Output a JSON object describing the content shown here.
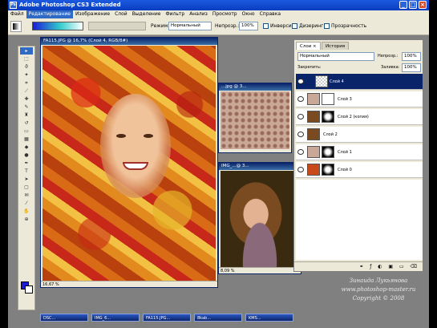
{
  "titlebar": {
    "title": "Adobe Photoshop CS3 Extended"
  },
  "menu": [
    "Файл",
    "Редактирование",
    "Изображение",
    "Слой",
    "Выделение",
    "Фильтр",
    "Анализ",
    "Просмотр",
    "Окно",
    "Справка"
  ],
  "options": {
    "mode_label": "Режим:",
    "mode_value": "Нормальный",
    "opacity_label": "Непрозр.:",
    "opacity_value": "100%",
    "invert": "Инверсия",
    "dither": "Дизеринг",
    "transparency": "Прозрачность"
  },
  "docs": {
    "main": {
      "title": "FA115.JPG @ 16,7% (Слой 4, RGB/8#)",
      "zoom": "16,67 %"
    },
    "pattern": {
      "title": "...jpg @ 3..."
    },
    "photo": {
      "title": "IMG_...@ 3..."
    },
    "photo_zoom": "8,09 %"
  },
  "layers": {
    "tab_layers": "Слои ×",
    "tab_history": "История",
    "blend": "Нормальный",
    "opacity_label": "Непрозр.:",
    "opacity_value": "100%",
    "lock_label": "Закрепить:",
    "fill_label": "Заливка:",
    "fill_value": "100%",
    "rows": [
      {
        "name": "Слой 4",
        "selected": true
      },
      {
        "name": "Слой 3",
        "selected": false
      },
      {
        "name": "Слой 2 (копия)",
        "selected": false
      },
      {
        "name": "Слой 2",
        "selected": false
      },
      {
        "name": "Слой 1",
        "selected": false
      },
      {
        "name": "Слой 0",
        "selected": false
      }
    ]
  },
  "taskbar": [
    "DSC...",
    "IMG_6...",
    "FA115.JPG...",
    "8kab...",
    "KMS..."
  ],
  "signature": {
    "line1": "Зинаида Лукьянова",
    "line2": "www.photoshop-master.ru",
    "line3": "Copyright © 2008"
  },
  "colors": {
    "selection": "#0a246a",
    "chrome": "#ece9d8",
    "workspace": "#808080"
  }
}
